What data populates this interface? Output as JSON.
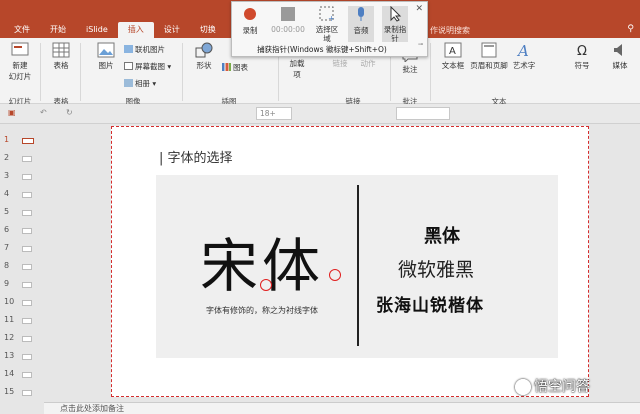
{
  "tabs": [
    "文件",
    "开始",
    "iSlide",
    "插入",
    "设计",
    "切换",
    "动"
  ],
  "active_tab": "插入",
  "tell_me": "作说明搜索",
  "ribbon": {
    "new_slide": "新建\n幻灯片",
    "table": "表格",
    "picture": "图片",
    "online_picture": "联机图片",
    "screenshot": "屏幕截图",
    "album": "相册",
    "shapes": "形状",
    "chart": "图表",
    "addins": "加载\n项",
    "link": "链接",
    "action": "动作",
    "comment": "批注",
    "textbox": "文本框",
    "header_footer": "页眉和页脚",
    "wordart": "艺术字",
    "symbol": "符号",
    "media": "媒体",
    "groups": {
      "slides": "幻灯片",
      "tables": "表格",
      "images": "图像",
      "illustrations": "插图",
      "links": "链接",
      "comments": "批注",
      "text": "文本"
    }
  },
  "recorder": {
    "record": "录制",
    "time": "00:00:00",
    "select_area": "选择区\n域",
    "audio": "音频",
    "record_pointer": "录制指\n针",
    "hint": "捕获指针(Windows 徽标键+Shift+O)"
  },
  "quickbar": {
    "font_size": "18+"
  },
  "thumbnails": [
    "1",
    "2",
    "3",
    "4",
    "5",
    "6",
    "7",
    "8",
    "9",
    "10",
    "11",
    "12",
    "13",
    "14",
    "15"
  ],
  "slide": {
    "title": "字体的选择",
    "songti": "宋体",
    "songti_caption": "字体有修饰的，称之为衬线字体",
    "heiti": "黑体",
    "yahei": "微软雅黑",
    "zhanghai": "张海山锐楷体"
  },
  "notes_placeholder": "点击此处添加备注",
  "watermark": "悟空问答",
  "colors": {
    "accent": "#b7472a",
    "dashed_border": "#d42d2d"
  }
}
